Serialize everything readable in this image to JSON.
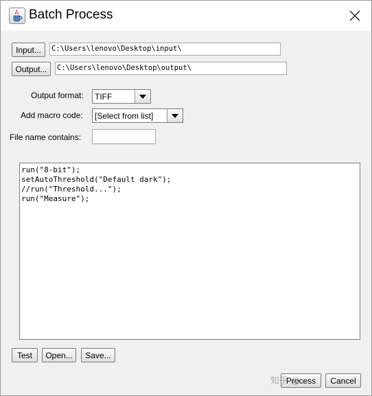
{
  "window": {
    "title": "Batch Process",
    "icon": "java-cup-icon",
    "close_icon": "close-icon"
  },
  "input": {
    "button_label": "Input...",
    "path": "C:\\Users\\lenovo\\Desktop\\input\\"
  },
  "output": {
    "button_label": "Output...",
    "path": "C:\\Users\\lenovo\\Desktop\\output\\"
  },
  "output_format": {
    "label": "Output format:",
    "value": "TIFF"
  },
  "macro_code": {
    "label": "Add macro code:",
    "value": "[Select from list]"
  },
  "file_name_contains": {
    "label": "File name contains:",
    "value": ""
  },
  "macro_lines": [
    "run(\"8-bit\");",
    "setAutoThreshold(\"Default dark\");",
    "//run(\"Threshold...\");",
    "run(\"Measure\");"
  ],
  "buttons": {
    "test": "Test",
    "open": "Open...",
    "save": "Save...",
    "process": "Process",
    "cancel": "Cancel"
  },
  "watermark": "知乎 @...",
  "colors": {
    "title_bar": "#ffffff",
    "window_bg": "#f0f0f0"
  }
}
